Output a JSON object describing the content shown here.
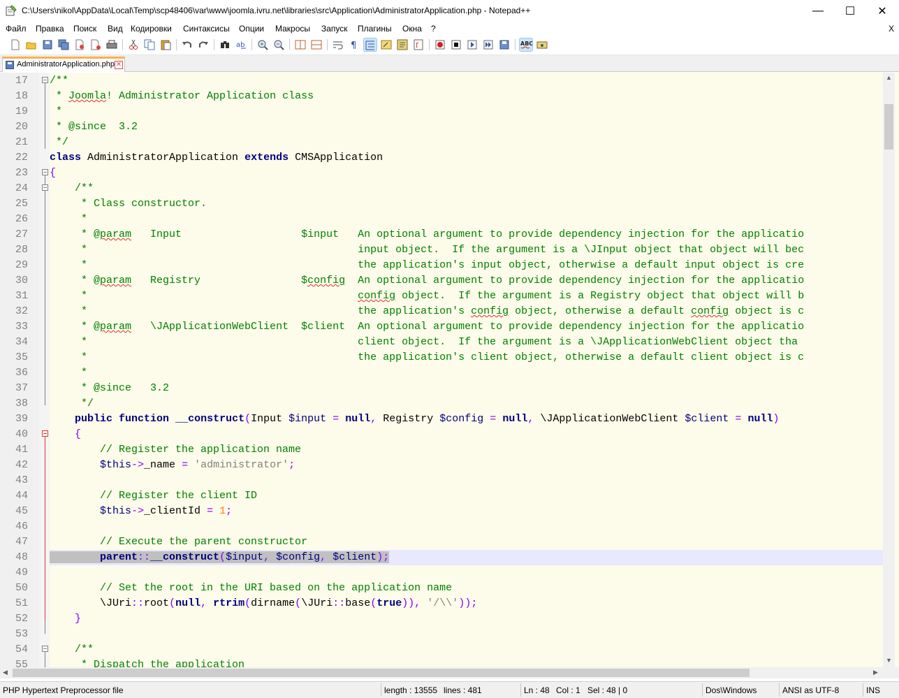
{
  "window": {
    "title": "C:\\Users\\nikol\\AppData\\Local\\Temp\\scp48406\\var\\www\\joomla.ivru.net\\libraries\\src\\Application\\AdministratorApplication.php - Notepad++",
    "minimize_glyph": "—",
    "maximize_glyph": "☐",
    "close_glyph": "✕"
  },
  "menu": {
    "items": [
      {
        "label": "Файл"
      },
      {
        "label": "Правка"
      },
      {
        "label": "Поиск"
      },
      {
        "label": "Вид"
      },
      {
        "label": "Кодировки"
      },
      {
        "label": "Синтаксисы"
      },
      {
        "label": "Опции"
      },
      {
        "label": "Макросы"
      },
      {
        "label": "Запуск"
      },
      {
        "label": "Плагины"
      },
      {
        "label": "Окна"
      },
      {
        "label": "?"
      }
    ],
    "close_doc": "X"
  },
  "toolbar": {
    "icons": [
      "new-file",
      "open-file",
      "save",
      "save-all",
      "close",
      "close-all",
      "print",
      "cut",
      "copy",
      "paste",
      "undo",
      "redo",
      "find",
      "replace",
      "zoom-in",
      "zoom-out",
      "sync-vertical",
      "sync-horizontal",
      "word-wrap",
      "show-all-chars",
      "indent-guide",
      "user-language",
      "doc-map",
      "function-list",
      "record-macro",
      "stop-record",
      "play-macro",
      "run-macro-multiple",
      "save-macro",
      "spellcheck",
      "spellcheck-options"
    ]
  },
  "tabs": [
    {
      "label": "AdministratorApplication.php",
      "close": "✕"
    }
  ],
  "editor": {
    "lines": [
      {
        "num": "17",
        "html": "<span class=\"c\">/**</span>"
      },
      {
        "num": "18",
        "html": "<span class=\"c\"> * <span class=\"squig\">Joomla</span>! Administrator Application class</span>"
      },
      {
        "num": "19",
        "html": "<span class=\"c\"> *</span>"
      },
      {
        "num": "20",
        "html": "<span class=\"c\"> * @since  3.2</span>"
      },
      {
        "num": "21",
        "html": "<span class=\"c\"> */</span>"
      },
      {
        "num": "22",
        "html": "<span class=\"k\">class</span> AdministratorApplication <span class=\"k\">extends</span> CMSApplication"
      },
      {
        "num": "23",
        "html": "<span class=\"o\">{</span>"
      },
      {
        "num": "24",
        "html": "    <span class=\"c\">/**</span>"
      },
      {
        "num": "25",
        "html": "<span class=\"c\">     * Class constructor.</span>"
      },
      {
        "num": "26",
        "html": "<span class=\"c\">     *</span>"
      },
      {
        "num": "27",
        "html": "<span class=\"c\">     * @<span class=\"squig\">param</span>   Input                   $input   An optional argument to provide dependency injection for the applicatio</span>"
      },
      {
        "num": "28",
        "html": "<span class=\"c\">     *                                           input object.  If the argument is a \\JInput object that object will bec</span>"
      },
      {
        "num": "29",
        "html": "<span class=\"c\">     *                                           the application's input object, otherwise a default input object is cre</span>"
      },
      {
        "num": "30",
        "html": "<span class=\"c\">     * @<span class=\"squig\">param</span>   Registry                $<span class=\"squig\">config</span>  An optional argument to provide dependency injection for the applicatio</span>"
      },
      {
        "num": "31",
        "html": "<span class=\"c\">     *                                           <span class=\"squig\">config</span> object.  If the argument is a Registry object that object will b</span>"
      },
      {
        "num": "32",
        "html": "<span class=\"c\">     *                                           the application's <span class=\"squig\">config</span> object, otherwise a default <span class=\"squig\">config</span> object is c</span>"
      },
      {
        "num": "33",
        "html": "<span class=\"c\">     * @<span class=\"squig\">param</span>   \\JApplicationWebClient  $client  An optional argument to provide dependency injection for the applicatio</span>"
      },
      {
        "num": "34",
        "html": "<span class=\"c\">     *                                           client object.  If the argument is a \\JApplicationWebClient object tha</span>"
      },
      {
        "num": "35",
        "html": "<span class=\"c\">     *                                           the application's client object, otherwise a default client object is c</span>"
      },
      {
        "num": "36",
        "html": "<span class=\"c\">     *</span>"
      },
      {
        "num": "37",
        "html": "<span class=\"c\">     * @since   3.2</span>"
      },
      {
        "num": "38",
        "html": "<span class=\"c\">     */</span>"
      },
      {
        "num": "39",
        "html": "    <span class=\"k\">public</span> <span class=\"k\">function</span> <span class=\"k\">__construct</span><span class=\"o\">(</span>Input <span class=\"v\">$input</span> <span class=\"o\">=</span> <span class=\"k\">null</span><span class=\"o\">,</span> Registry <span class=\"v\">$config</span> <span class=\"o\">=</span> <span class=\"k\">null</span><span class=\"o\">,</span> \\JApplicationWebClient <span class=\"v\">$client</span> <span class=\"o\">=</span> <span class=\"k\">null</span><span class=\"o\">)</span>"
      },
      {
        "num": "40",
        "html": "    <span class=\"o\">{</span>"
      },
      {
        "num": "41",
        "html": "        <span class=\"c\">// Register the application name</span>"
      },
      {
        "num": "42",
        "html": "        <span class=\"v\">$this</span><span class=\"o\">-&gt;</span>_name <span class=\"o\">=</span> <span class=\"s\">'administrator'</span><span class=\"o\">;</span>"
      },
      {
        "num": "43",
        "html": ""
      },
      {
        "num": "44",
        "html": "        <span class=\"c\">// Register the client ID</span>"
      },
      {
        "num": "45",
        "html": "        <span class=\"v\">$this</span><span class=\"o\">-&gt;</span>_clientId <span class=\"o\">=</span> <span class=\"n\">1</span><span class=\"o\">;</span>"
      },
      {
        "num": "46",
        "html": ""
      },
      {
        "num": "47",
        "html": "        <span class=\"c\">// Execute the parent constructor</span>"
      },
      {
        "num": "48",
        "html": "<span class=\"sel\">        <span class=\"k\">parent</span><span class=\"o\">::</span><span class=\"k\">__construct</span><span class=\"o\">(</span><span class=\"v\">$input</span><span class=\"o\">,</span> <span class=\"v\">$config</span><span class=\"o\">,</span> <span class=\"v\">$client</span><span class=\"o\">);</span></span>",
        "current": true
      },
      {
        "num": "49",
        "html": ""
      },
      {
        "num": "50",
        "html": "        <span class=\"c\">// Set the root in the URI based on the application name</span>"
      },
      {
        "num": "51",
        "html": "        \\JUri<span class=\"o\">::</span>root<span class=\"o\">(</span><span class=\"k\">null</span><span class=\"o\">,</span> <span class=\"k\">rtrim</span><span class=\"o\">(</span>dirname<span class=\"o\">(</span>\\JUri<span class=\"o\">::</span>base<span class=\"o\">(</span><span class=\"k\">true</span><span class=\"o\">)),</span> <span class=\"s\">'/\\\\'</span><span class=\"o\">));</span>"
      },
      {
        "num": "52",
        "html": "    <span class=\"o\">}</span>"
      },
      {
        "num": "53",
        "html": ""
      },
      {
        "num": "54",
        "html": "    <span class=\"c\">/**</span>"
      },
      {
        "num": "55",
        "html": "<span class=\"c\">     * Dispatch the application</span>"
      }
    ]
  },
  "statusbar": {
    "filetype": "PHP Hypertext Preprocessor file",
    "length": "length : 13555",
    "lines": "lines : 481",
    "ln": "Ln : 48",
    "col": "Col : 1",
    "sel": "Sel : 48 | 0",
    "eol": "Dos\\Windows",
    "encoding": "ANSI as UTF-8",
    "mode": "INS"
  }
}
